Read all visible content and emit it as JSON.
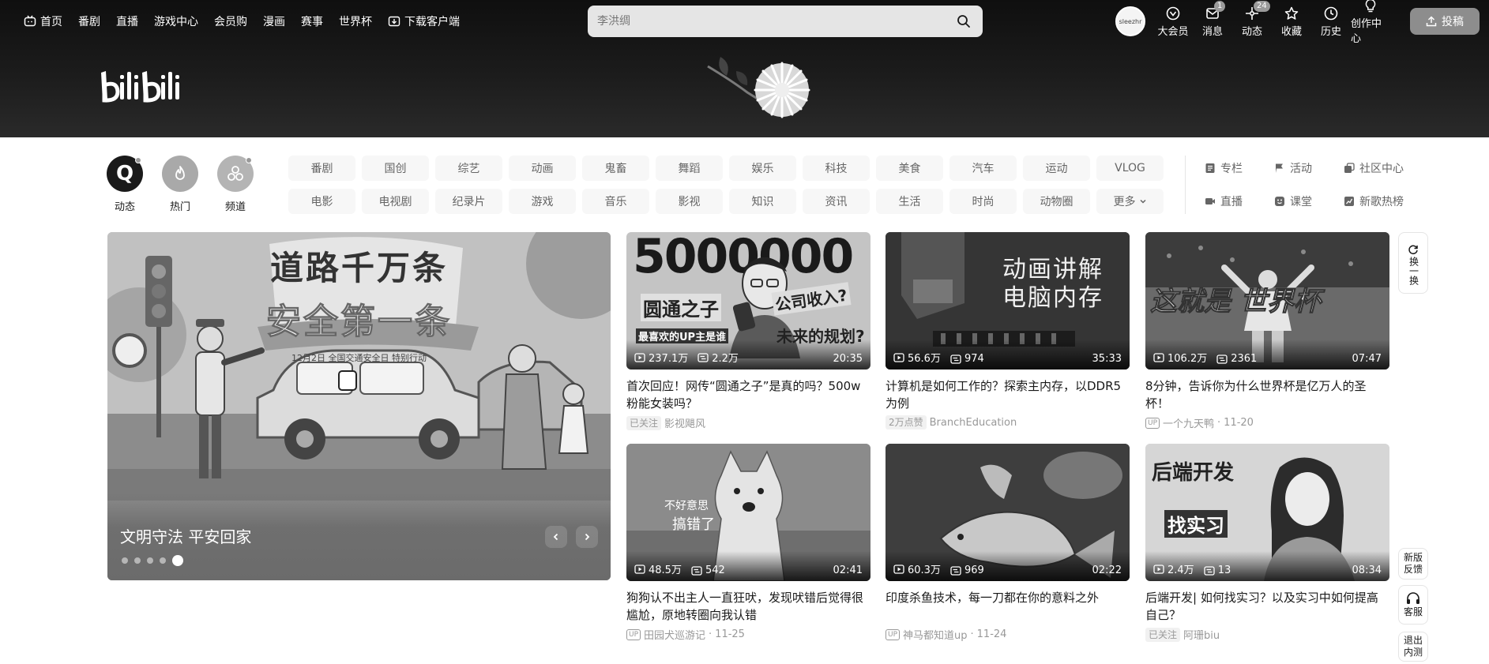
{
  "nav": {
    "left": [
      {
        "label": "首页",
        "icon": "tv-icon"
      },
      {
        "label": "番剧"
      },
      {
        "label": "直播"
      },
      {
        "label": "游戏中心"
      },
      {
        "label": "会员购"
      },
      {
        "label": "漫画"
      },
      {
        "label": "赛事"
      },
      {
        "label": "世界杯"
      },
      {
        "label": "下载客户端",
        "icon": "download-icon"
      }
    ],
    "search_placeholder": "李洪绸",
    "avatar_text": "sleezhr",
    "right": [
      {
        "label": "大会员"
      },
      {
        "label": "消息",
        "badge": "1"
      },
      {
        "label": "动态",
        "badge": "24"
      },
      {
        "label": "收藏"
      },
      {
        "label": "历史"
      },
      {
        "label": "创作中心"
      }
    ],
    "upload": "投稿"
  },
  "quick": [
    {
      "label": "动态",
      "icon_text": "Q"
    },
    {
      "label": "热门"
    },
    {
      "label": "频道"
    }
  ],
  "channels": [
    "番剧",
    "国创",
    "综艺",
    "动画",
    "鬼畜",
    "舞蹈",
    "娱乐",
    "科技",
    "美食",
    "汽车",
    "运动",
    "VLOG",
    "电影",
    "电视剧",
    "纪录片",
    "游戏",
    "音乐",
    "影视",
    "知识",
    "资讯",
    "生活",
    "时尚",
    "动物圈",
    "更多"
  ],
  "extra": [
    "专栏",
    "活动",
    "社区中心",
    "直播",
    "课堂",
    "新歌热榜"
  ],
  "carousel": {
    "title": "文明守法 平安回家",
    "poster_line1": "道路千万条",
    "poster_line2": "安全第一条",
    "poster_sub": "12月2日 全国交通安全日 特别行动"
  },
  "videos": [
    {
      "thumb_big": "5000000",
      "thumb_a": "圆通之子",
      "thumb_b": "公司收入?",
      "thumb_c": "最喜欢的UP主是谁",
      "thumb_d": "未来的规划?",
      "views": "237.1万",
      "danmaku": "2.2万",
      "duration": "20:35",
      "title": "首次回应！网传“圆通之子”是真的吗？500w粉能女装吗？",
      "tag": "已关注",
      "author": "影视飓风",
      "date": ""
    },
    {
      "thumb_a": "动画讲解",
      "thumb_b": "电脑内存",
      "views": "56.6万",
      "danmaku": "974",
      "duration": "35:33",
      "title": "计算机是如何工作的？探索主内存，以DDR5为例",
      "tag": "2万点赞",
      "author": "BranchEducation",
      "date": ""
    },
    {
      "thumb_a": "这就是 世界杯",
      "views": "106.2万",
      "danmaku": "2361",
      "duration": "07:47",
      "title": "8分钟，告诉你为什么世界杯是亿万人的圣杯！",
      "tag": "",
      "author": "一个九天鸭",
      "date": "11-20"
    },
    {
      "thumb_a": "不好意思",
      "thumb_b": "搞错了",
      "views": "48.5万",
      "danmaku": "542",
      "duration": "02:41",
      "title": "狗狗认不出主人一直狂吠，发现吠错后觉得很尴尬，原地转圈向我认错",
      "tag": "",
      "author": "田园犬巡游记",
      "date": "11-25"
    },
    {
      "views": "60.3万",
      "danmaku": "969",
      "duration": "02:22",
      "title": "印度杀鱼技术，每一刀都在你的意料之外",
      "tag": "",
      "author": "神马都知道up",
      "date": "11-24"
    },
    {
      "thumb_a": "后端开发",
      "thumb_b": "找实习",
      "views": "2.4万",
      "danmaku": "13",
      "duration": "08:34",
      "title": "后端开发| 如何找实习？以及实习中如何提高自己？",
      "tag": "已关注",
      "author": "阿珊biu",
      "date": ""
    }
  ],
  "side": {
    "refresh": "换一换",
    "feedback": "新版反馈",
    "service": "客服",
    "old": "退出内测"
  }
}
